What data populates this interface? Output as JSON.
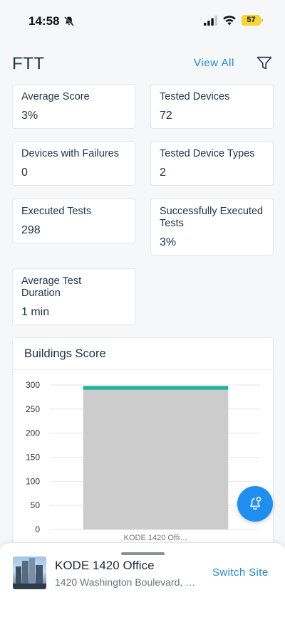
{
  "status_bar": {
    "time": "14:58",
    "battery": "57",
    "icons": [
      "bell-off-icon",
      "signal-icon",
      "wifi-icon",
      "battery-icon"
    ]
  },
  "header": {
    "title": "FTT",
    "view_all": "View All",
    "filter_icon": "filter-icon"
  },
  "stats": {
    "average_score": {
      "label": "Average Score",
      "value": "3%"
    },
    "tested_devices": {
      "label": "Tested Devices",
      "value": "72"
    },
    "devices_with_failures": {
      "label": "Devices with Failures",
      "value": "0"
    },
    "tested_device_types": {
      "label": "Tested Device Types",
      "value": "2"
    },
    "executed_tests": {
      "label": "Executed Tests",
      "value": "298"
    },
    "successfully_executed_tests": {
      "label": "Successfully Executed Tests",
      "value": "3%"
    },
    "average_test_duration": {
      "label": "Average Test Duration",
      "value": "1 min"
    }
  },
  "buildings_chart": {
    "title": "Buildings Score"
  },
  "chart_data": {
    "type": "bar",
    "title": "Buildings Score",
    "categories": [
      "KODE 1420 Offi…"
    ],
    "series": [
      {
        "color": "#cccccc",
        "values": [
          290
        ]
      },
      {
        "color": "#1fb39a",
        "values": [
          8
        ]
      }
    ],
    "stacked": true,
    "y_ticks": [
      0,
      50,
      100,
      150,
      200,
      250,
      300
    ],
    "ylim": [
      0,
      300
    ],
    "grid": true
  },
  "fab": {
    "icon": "bell-add-icon",
    "color": "#1e8ef0"
  },
  "bottom_sheet": {
    "site_name": "KODE 1420 Office",
    "site_address": "1420 Washington Boulevard, …",
    "switch_site": "Switch Site"
  },
  "colors": {
    "accent": "#1e87d6",
    "text": "#22334a",
    "bar_gray": "#cccccc",
    "bar_teal": "#1fb39a"
  }
}
